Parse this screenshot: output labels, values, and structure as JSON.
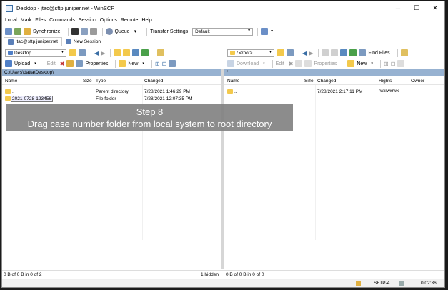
{
  "window": {
    "title": "Desktop - jtac@sftp.juniper.net - WinSCP",
    "minimize": "─",
    "maximize": "☐",
    "close": "✕"
  },
  "menu": [
    "Local",
    "Mark",
    "Files",
    "Commands",
    "Session",
    "Options",
    "Remote",
    "Help"
  ],
  "toolbar": {
    "synchronize": "Synchronize",
    "queue": "Queue",
    "transfer_settings_label": "Transfer Settings",
    "transfer_settings_value": "Default"
  },
  "tabs": [
    {
      "label": "jtac@sftp.juniper.net"
    },
    {
      "label": "New Session"
    }
  ],
  "local": {
    "location": "Desktop",
    "upload": "Upload",
    "edit": "Edit",
    "properties": "Properties",
    "new": "New",
    "path": "C:\\Users\\datta\\Desktop\\",
    "columns": {
      "name": "Name",
      "size": "Size",
      "type": "Type",
      "changed": "Changed"
    },
    "rows": [
      {
        "name": "..",
        "size": "",
        "type": "Parent directory",
        "changed": "7/28/2021 1:46:29 PM"
      },
      {
        "name": "2021-0728-123456",
        "size": "",
        "type": "File folder",
        "changed": "7/28/2021 12:07:35 PM"
      }
    ],
    "status_left": "0 B of 0 B in 0 of 2",
    "status_right": "1 hidden"
  },
  "remote": {
    "location": "/ <root>",
    "find_files": "Find Files",
    "download": "Download",
    "edit": "Edit",
    "properties": "Properties",
    "new": "New",
    "path": "/",
    "columns": {
      "name": "Name",
      "size": "Size",
      "changed": "Changed",
      "rights": "Rights",
      "owner": "Owner"
    },
    "rows": [
      {
        "name": "..",
        "size": "",
        "changed": "7/28/2021 2:17:11 PM",
        "rights": "rwxrwxrwx",
        "owner": ""
      }
    ],
    "status_left": "0 B of 0 B in 0 of 0"
  },
  "bottom": {
    "protocol": "SFTP-4",
    "time": "0:02:36"
  },
  "overlay": {
    "step": "Step 8",
    "instruction": "Drag case number folder from local system to root directory"
  },
  "colors": {
    "path_bar": "#97b2d1",
    "folder": "#f3c94c",
    "overlay": "#808080"
  }
}
